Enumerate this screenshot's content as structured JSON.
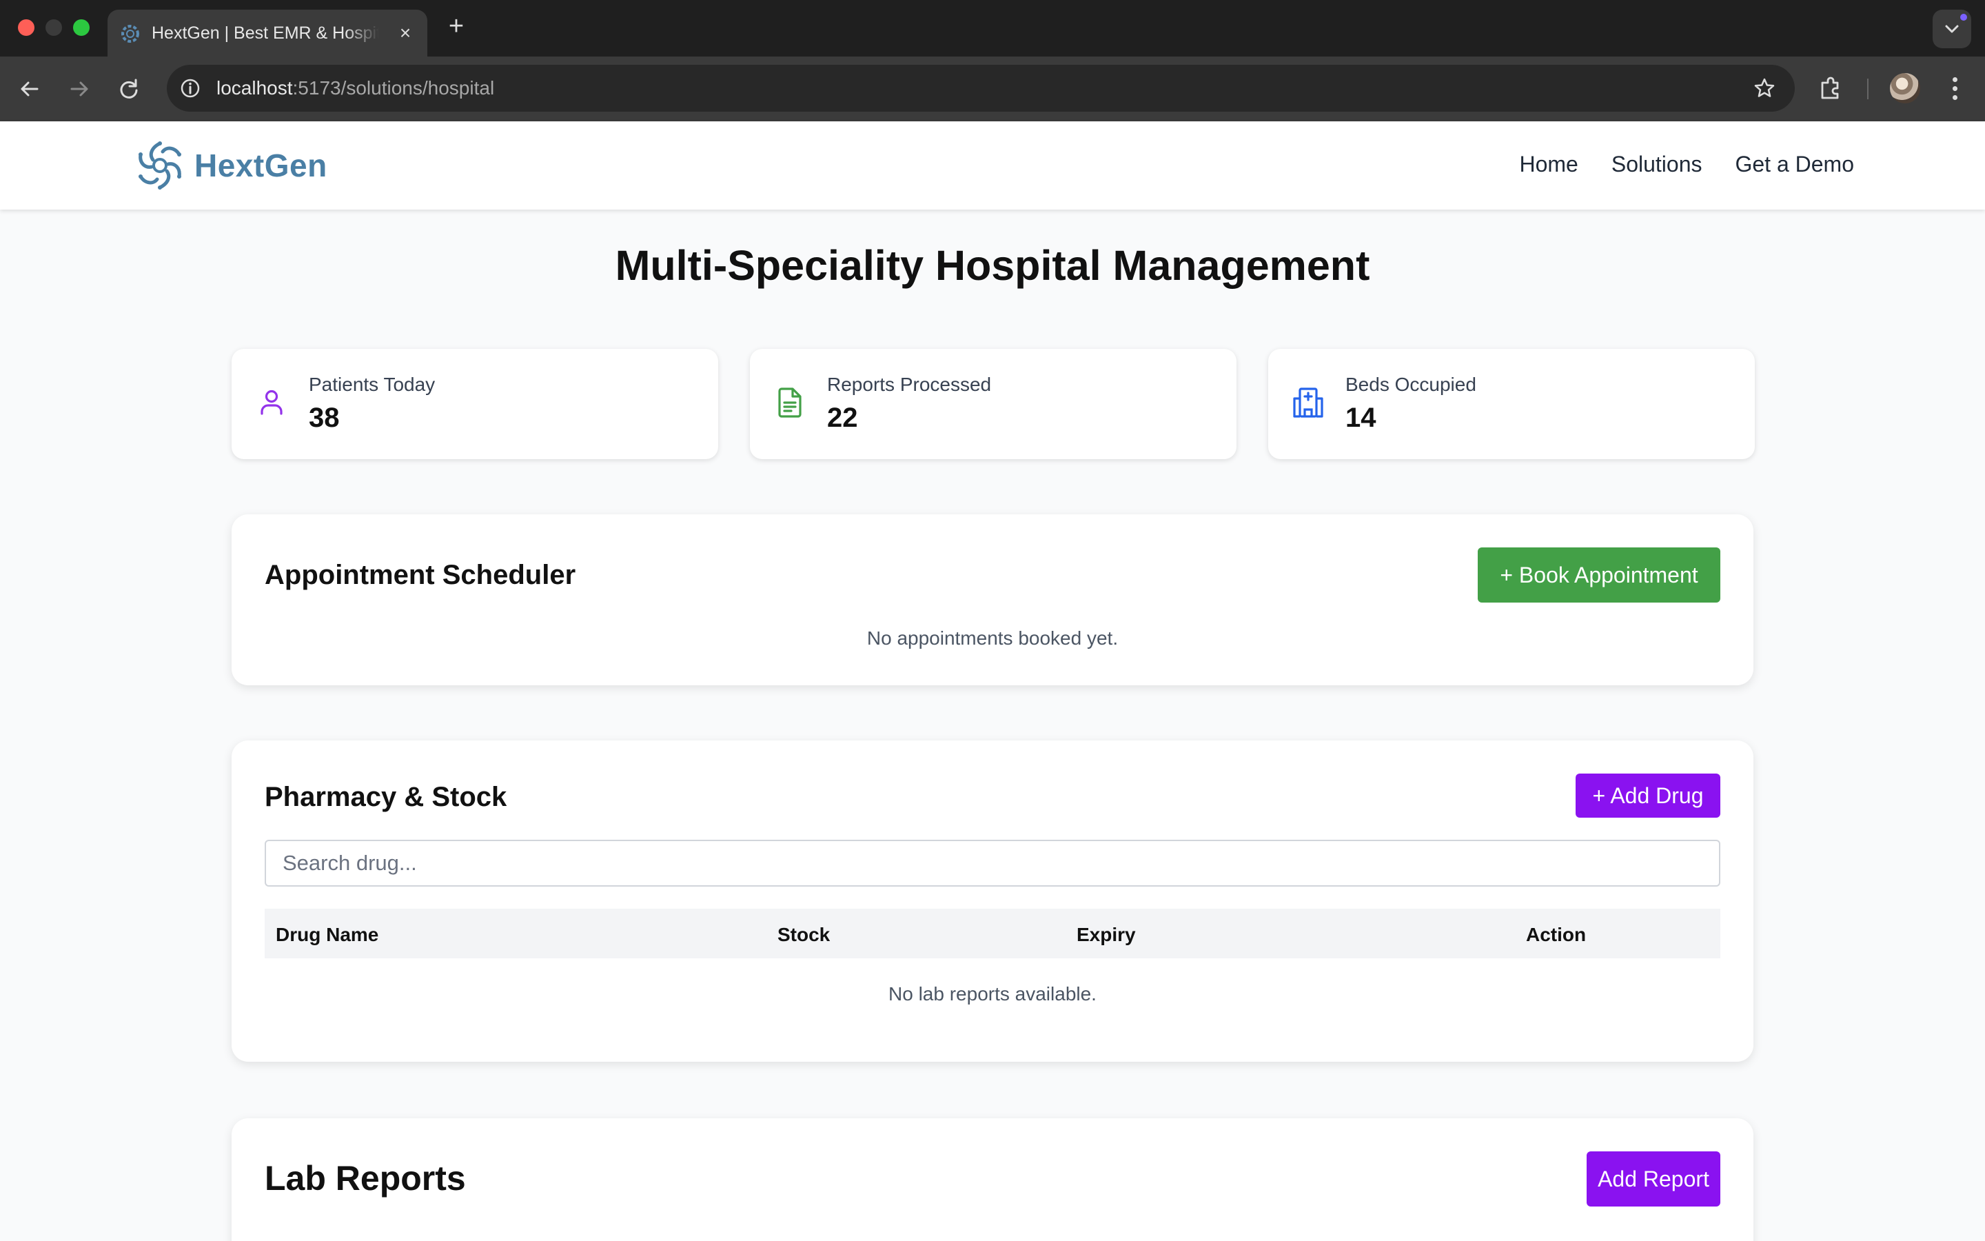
{
  "browser": {
    "tab_title": "HextGen | Best EMR & Hospital Management",
    "tab_close_icon": "×",
    "new_tab_icon": "+",
    "url_host": "localhost",
    "url_rest": ":5173/solutions/hospital"
  },
  "header": {
    "brand": "HextGen",
    "brand_color": "#4a7fa5",
    "nav": [
      "Home",
      "Solutions",
      "Get a Demo"
    ]
  },
  "page": {
    "title": "Multi-Speciality Hospital Management"
  },
  "stats": [
    {
      "label": "Patients Today",
      "value": "38",
      "icon": "user-icon",
      "color": "#9333ea"
    },
    {
      "label": "Reports Processed",
      "value": "22",
      "icon": "file-text-icon",
      "color": "#43a047"
    },
    {
      "label": "Beds Occupied",
      "value": "14",
      "icon": "hospital-icon",
      "color": "#2563eb"
    }
  ],
  "appointments": {
    "title": "Appointment Scheduler",
    "button": "+ Book Appointment",
    "empty": "No appointments booked yet."
  },
  "pharmacy": {
    "title": "Pharmacy & Stock",
    "button": "+ Add Drug",
    "search_placeholder": "Search drug...",
    "columns": [
      "Drug Name",
      "Stock",
      "Expiry",
      "Action"
    ],
    "empty": "No lab reports available."
  },
  "lab_reports": {
    "title": "Lab Reports",
    "button": "Add Report"
  },
  "colors": {
    "accent_green": "#43a047",
    "accent_purple": "#8a12f0"
  }
}
